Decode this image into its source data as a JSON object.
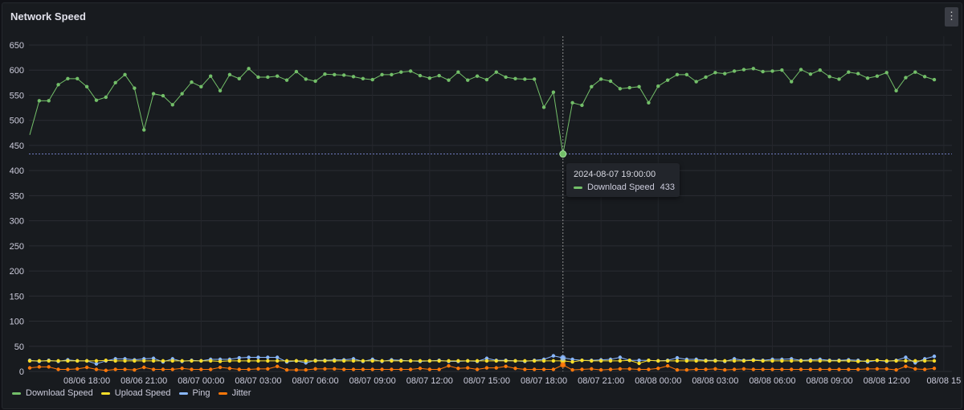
{
  "panel": {
    "title": "Network Speed",
    "menu_icon": "kebab-menu-icon"
  },
  "tooltip": {
    "time": "2024-08-07 19:00:00",
    "series": "Download Speed",
    "value": "433",
    "color": "#73bf69"
  },
  "chart_data": {
    "type": "line",
    "title": "Network Speed",
    "xlabel": "",
    "ylabel": "",
    "ylim": [
      0,
      650
    ],
    "y_ticks": [
      "0",
      "50",
      "100",
      "150",
      "200",
      "250",
      "300",
      "350",
      "400",
      "450",
      "500",
      "550",
      "600",
      "650"
    ],
    "x_ticks": [
      "08/06 18:00",
      "08/06 21:00",
      "08/07 00:00",
      "08/07 03:00",
      "08/07 06:00",
      "08/07 09:00",
      "08/07 12:00",
      "08/07 15:00",
      "08/07 18:00",
      "08/07 21:00",
      "08/08 00:00",
      "08/08 03:00",
      "08/08 06:00",
      "08/08 09:00",
      "08/08 12:00",
      "08/08 15"
    ],
    "grid": true,
    "legend_position": "bottom-left",
    "x": [
      "08/06 15:00",
      "08/06 15:30",
      "08/06 16:00",
      "08/06 16:30",
      "08/06 17:00",
      "08/06 17:30",
      "08/06 18:00",
      "08/06 18:30",
      "08/06 19:00",
      "08/06 19:30",
      "08/06 20:00",
      "08/06 20:30",
      "08/06 21:00",
      "08/06 21:30",
      "08/06 22:00",
      "08/06 22:30",
      "08/06 23:00",
      "08/06 23:30",
      "08/07 00:00",
      "08/07 00:30",
      "08/07 01:00",
      "08/07 01:30",
      "08/07 02:00",
      "08/07 02:30",
      "08/07 03:00",
      "08/07 03:30",
      "08/07 04:00",
      "08/07 04:30",
      "08/07 05:00",
      "08/07 05:30",
      "08/07 06:00",
      "08/07 06:30",
      "08/07 07:00",
      "08/07 07:30",
      "08/07 08:00",
      "08/07 08:30",
      "08/07 09:00",
      "08/07 09:30",
      "08/07 10:00",
      "08/07 10:30",
      "08/07 11:00",
      "08/07 11:30",
      "08/07 12:00",
      "08/07 12:30",
      "08/07 13:00",
      "08/07 13:30",
      "08/07 14:00",
      "08/07 14:30",
      "08/07 15:00",
      "08/07 15:30",
      "08/07 16:00",
      "08/07 16:30",
      "08/07 17:00",
      "08/07 17:30",
      "08/07 18:00",
      "08/07 18:30",
      "08/07 19:00",
      "08/07 19:30",
      "08/07 20:00",
      "08/07 20:30",
      "08/07 21:00",
      "08/07 21:30",
      "08/07 22:00",
      "08/07 22:30",
      "08/07 23:00",
      "08/07 23:30",
      "08/08 00:00",
      "08/08 00:30",
      "08/08 01:00",
      "08/08 01:30",
      "08/08 02:00",
      "08/08 02:30",
      "08/08 03:00",
      "08/08 03:30",
      "08/08 04:00",
      "08/08 04:30",
      "08/08 05:00",
      "08/08 05:30",
      "08/08 06:00",
      "08/08 06:30",
      "08/08 07:00",
      "08/08 07:30",
      "08/08 08:00",
      "08/08 08:30",
      "08/08 09:00",
      "08/08 09:30",
      "08/08 10:00",
      "08/08 10:30",
      "08/08 11:00",
      "08/08 11:30",
      "08/08 12:00",
      "08/08 12:30",
      "08/08 13:00",
      "08/08 13:30",
      "08/08 14:00",
      "08/08 14:30"
    ],
    "series": [
      {
        "name": "Download Speed",
        "color": "#73bf69",
        "values": [
          471,
          539,
          539,
          571,
          583,
          583,
          567,
          540,
          546,
          575,
          591,
          564,
          481,
          553,
          549,
          531,
          553,
          576,
          567,
          588,
          559,
          591,
          583,
          603,
          586,
          586,
          588,
          580,
          597,
          582,
          578,
          592,
          591,
          590,
          587,
          583,
          581,
          591,
          591,
          596,
          598,
          589,
          584,
          589,
          580,
          596,
          580,
          588,
          581,
          596,
          586,
          583,
          582,
          582,
          526,
          556,
          433,
          535,
          530,
          567,
          582,
          578,
          563,
          565,
          567,
          535,
          568,
          580,
          591,
          591,
          577,
          586,
          595,
          593,
          598,
          601,
          603,
          597,
          598,
          600,
          577,
          601,
          592,
          600,
          587,
          582,
          596,
          593,
          584,
          588,
          595,
          559,
          585,
          596,
          587,
          581
        ]
      },
      {
        "name": "Upload Speed",
        "color": "#fade2a",
        "values": [
          21,
          21,
          21,
          21,
          21,
          21,
          21,
          21,
          22,
          21,
          21,
          21,
          21,
          21,
          21,
          21,
          21,
          21,
          21,
          21,
          20,
          21,
          21,
          21,
          21,
          21,
          21,
          21,
          21,
          21,
          21,
          21,
          21,
          21,
          21,
          21,
          21,
          21,
          21,
          21,
          21,
          21,
          21,
          21,
          21,
          21,
          21,
          21,
          21,
          21,
          21,
          21,
          21,
          21,
          21,
          21,
          21,
          19,
          22,
          21,
          21,
          21,
          21,
          22,
          16,
          22,
          21,
          21,
          21,
          21,
          21,
          21,
          21,
          21,
          21,
          21,
          22,
          21,
          21,
          21,
          21,
          21,
          21,
          21,
          21,
          21,
          21,
          20,
          21,
          22,
          21,
          21,
          21,
          21,
          21,
          21
        ]
      },
      {
        "name": "Ping",
        "color": "#8ab8ff",
        "values": [
          22,
          20,
          22,
          20,
          23,
          21,
          21,
          15,
          21,
          25,
          25,
          23,
          25,
          26,
          19,
          25,
          20,
          22,
          21,
          24,
          24,
          24,
          27,
          28,
          28,
          28,
          28,
          19,
          21,
          17,
          22,
          22,
          23,
          23,
          25,
          20,
          24,
          20,
          23,
          22,
          21,
          20,
          21,
          22,
          20,
          20,
          21,
          20,
          26,
          22,
          22,
          21,
          20,
          22,
          24,
          31,
          27,
          24,
          22,
          22,
          23,
          24,
          28,
          22,
          22,
          22,
          21,
          22,
          27,
          24,
          24,
          22,
          22,
          20,
          25,
          22,
          23,
          22,
          24,
          24,
          25,
          22,
          23,
          24,
          22,
          22,
          23,
          22,
          19,
          22,
          20,
          22,
          28,
          17,
          25,
          30
        ]
      },
      {
        "name": "Jitter",
        "color": "#ff780a",
        "values": [
          7,
          9,
          9,
          4,
          4,
          5,
          8,
          4,
          2,
          4,
          4,
          3,
          8,
          4,
          4,
          4,
          6,
          4,
          4,
          4,
          8,
          6,
          4,
          4,
          5,
          5,
          10,
          3,
          3,
          3,
          5,
          5,
          5,
          4,
          4,
          4,
          4,
          4,
          4,
          4,
          4,
          6,
          4,
          4,
          11,
          6,
          7,
          4,
          7,
          7,
          10,
          6,
          4,
          4,
          4,
          4,
          13,
          3,
          4,
          5,
          3,
          4,
          5,
          5,
          4,
          4,
          6,
          11,
          3,
          3,
          4,
          4,
          5,
          3,
          4,
          5,
          4,
          4,
          4,
          4,
          4,
          4,
          4,
          4,
          4,
          4,
          4,
          4,
          5,
          5,
          5,
          3,
          10,
          5,
          4,
          6
        ]
      }
    ],
    "highlight": {
      "series": "Download Speed",
      "x": "08/07 19:00",
      "value": 433
    }
  }
}
